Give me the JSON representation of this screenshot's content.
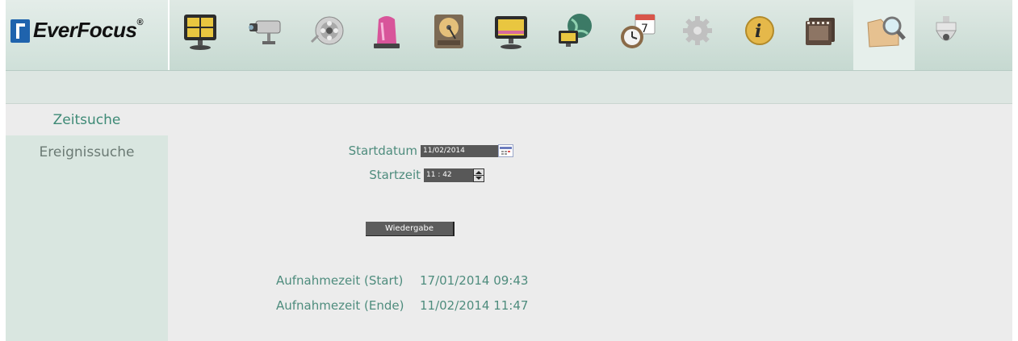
{
  "brand": {
    "name": "EverFocus",
    "reg": "®"
  },
  "toolbar": {
    "icons": [
      "live-view-icon",
      "camera-icon",
      "record-reel-icon",
      "alarm-light-icon",
      "hdd-icon",
      "monitor-icon",
      "network-globe-icon",
      "schedule-clock-icon",
      "gear-icon",
      "info-icon",
      "film-icon",
      "search-folder-icon",
      "dome-camera-icon"
    ],
    "active_icon": "search-folder-icon"
  },
  "sidebar": {
    "items": [
      {
        "label": "Zeitsuche",
        "active": true
      },
      {
        "label": "Ereignissuche",
        "active": false
      }
    ]
  },
  "form": {
    "start_date_label": "Startdatum",
    "start_date_value": "11/02/2014",
    "start_time_label": "Startzeit",
    "start_time_value": "11 : 42",
    "play_label": "Wiedergabe"
  },
  "recording": {
    "start_label": "Aufnahmezeit (Start)",
    "start_value": "17/01/2014 09:43",
    "end_label": "Aufnahmezeit (Ende)",
    "end_value": "11/02/2014 11:47"
  },
  "colors": {
    "accent": "#4e8c7d",
    "field": "#585858",
    "sidebar": "#d9e6e0"
  }
}
